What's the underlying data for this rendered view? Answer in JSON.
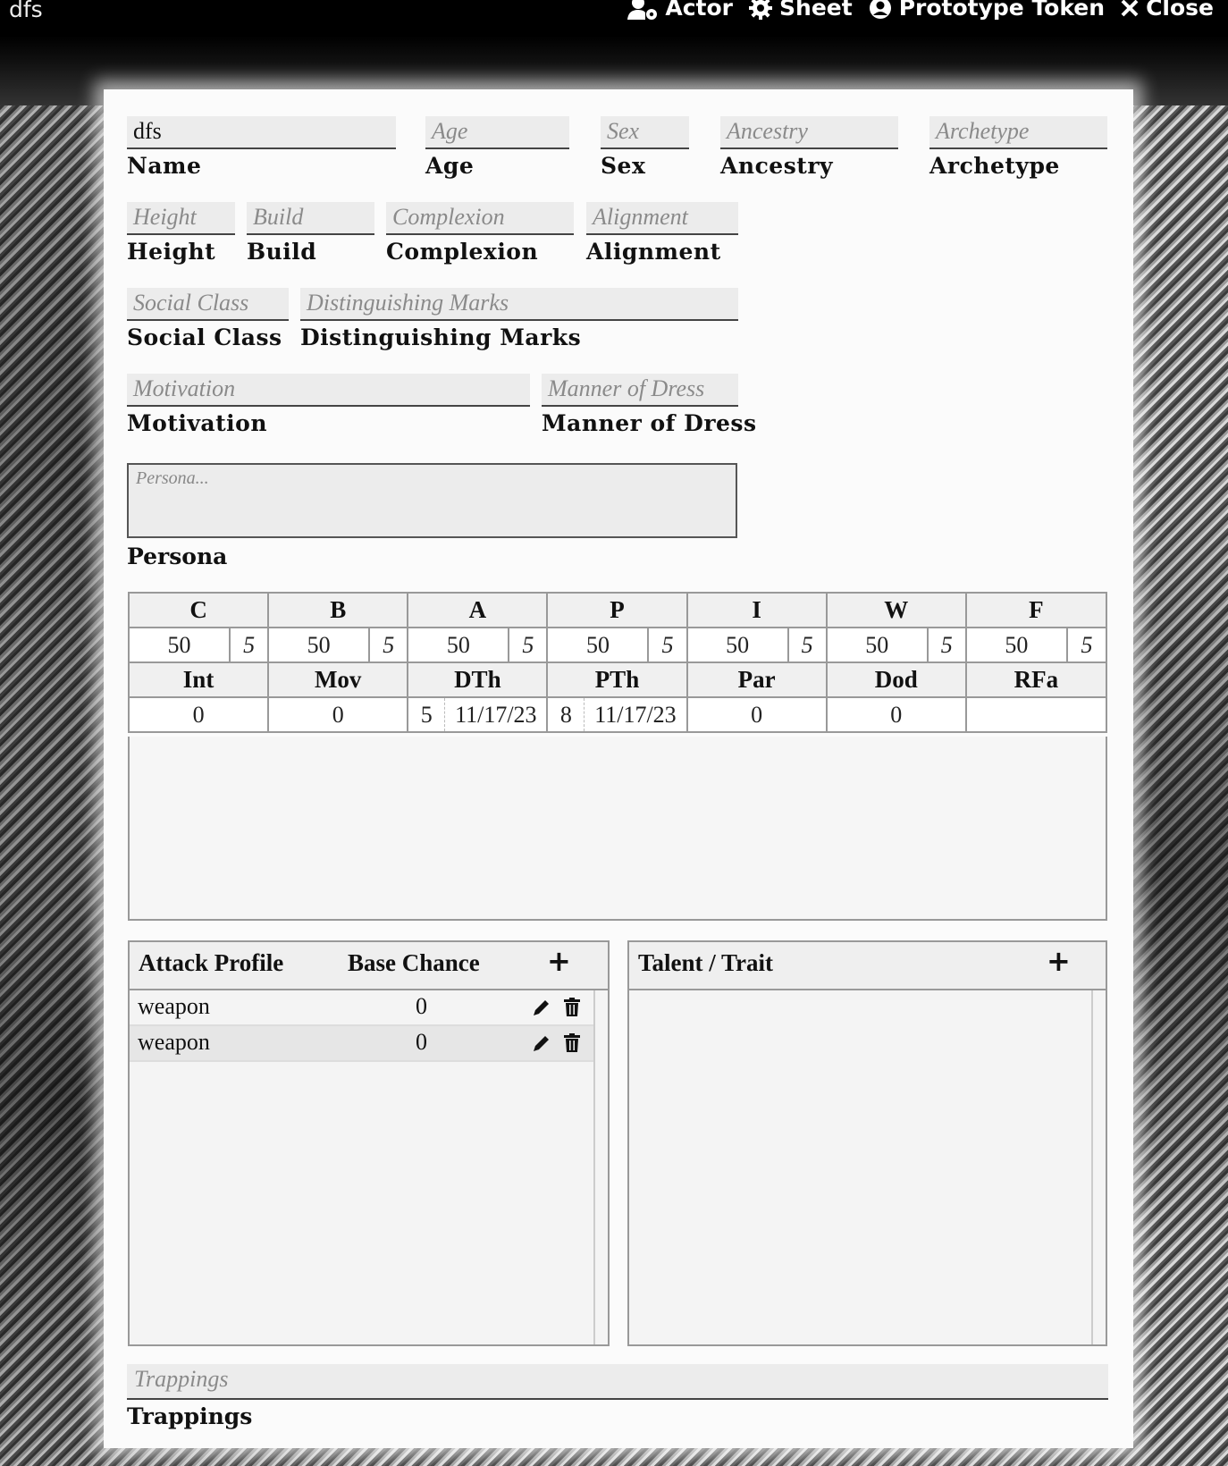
{
  "window": {
    "title": "dfs",
    "controls": {
      "actor": "Actor",
      "sheet": "Sheet",
      "token": "Prototype Token",
      "close": "Close"
    }
  },
  "fields": {
    "name": {
      "value": "dfs",
      "label": "Name"
    },
    "age": {
      "placeholder": "Age",
      "label": "Age"
    },
    "sex": {
      "placeholder": "Sex",
      "label": "Sex"
    },
    "ancestry": {
      "placeholder": "Ancestry",
      "label": "Ancestry"
    },
    "archetype": {
      "placeholder": "Archetype",
      "label": "Archetype"
    },
    "height": {
      "placeholder": "Height",
      "label": "Height"
    },
    "build": {
      "placeholder": "Build",
      "label": "Build"
    },
    "complexion": {
      "placeholder": "Complexion",
      "label": "Complexion"
    },
    "alignment": {
      "placeholder": "Alignment",
      "label": "Alignment"
    },
    "social_class": {
      "placeholder": "Social Class",
      "label": "Social Class"
    },
    "distinguishing_marks": {
      "placeholder": "Distinguishing Marks",
      "label": "Distinguishing Marks"
    },
    "motivation": {
      "placeholder": "Motivation",
      "label": "Motivation"
    },
    "manner_of_dress": {
      "placeholder": "Manner of Dress",
      "label": "Manner of Dress"
    },
    "persona": {
      "placeholder": "Persona...",
      "label": "Persona"
    },
    "trappings": {
      "placeholder": "Trappings",
      "label": "Trappings"
    }
  },
  "stats": {
    "chars": [
      {
        "h": "C",
        "v": "50",
        "b": "5"
      },
      {
        "h": "B",
        "v": "50",
        "b": "5"
      },
      {
        "h": "A",
        "v": "50",
        "b": "5"
      },
      {
        "h": "P",
        "v": "50",
        "b": "5"
      },
      {
        "h": "I",
        "v": "50",
        "b": "5"
      },
      {
        "h": "W",
        "v": "50",
        "b": "5"
      },
      {
        "h": "F",
        "v": "50",
        "b": "5"
      }
    ],
    "derived": [
      {
        "h": "Int",
        "v": "0"
      },
      {
        "h": "Mov",
        "v": "0"
      },
      {
        "h": "DTh",
        "pre": "5",
        "v": "11/17/23"
      },
      {
        "h": "PTh",
        "pre": "8",
        "v": "11/17/23"
      },
      {
        "h": "Par",
        "v": "0"
      },
      {
        "h": "Dod",
        "v": "0"
      },
      {
        "h": "RFa",
        "v": ""
      }
    ]
  },
  "attacks": {
    "header": {
      "profile": "Attack Profile",
      "chance": "Base Chance",
      "add": "+"
    },
    "rows": [
      {
        "name": "weapon",
        "chance": "0"
      },
      {
        "name": "weapon",
        "chance": "0"
      }
    ]
  },
  "talents": {
    "header": {
      "title": "Talent / Trait",
      "add": "+"
    }
  }
}
